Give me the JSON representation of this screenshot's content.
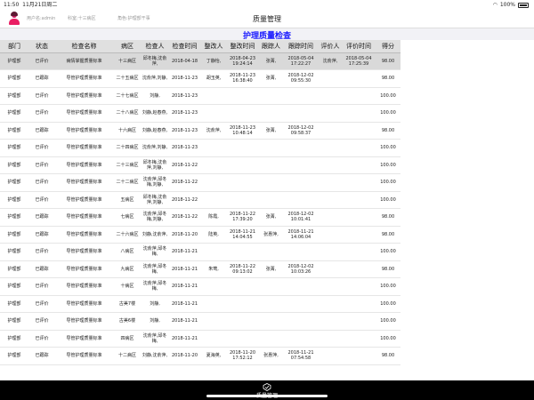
{
  "status_bar": {
    "time": "11:50",
    "date": "11月21日周二",
    "battery": "100%"
  },
  "header": {
    "user": "用户名:admin",
    "ward": "科室:十三病区",
    "role": "角色:护理部干事",
    "title": "质量管理"
  },
  "banner": {
    "title": "护理质量检查"
  },
  "table": {
    "columns": [
      "部门",
      "状态",
      "检查名称",
      "病区",
      "检查人",
      "检查时间",
      "整改人",
      "整改时间",
      "跟踪人",
      "跟踪时间",
      "评价人",
      "评价时间",
      "得分"
    ],
    "rows": [
      [
        "护理部",
        "已评价",
        "病情掌握质量标准",
        "十三病区",
        "邱冬梅,沈俞萍,",
        "2018-04-18",
        "丁静怡,",
        "2018-04-23 19:24:14",
        "张菁,",
        "2018-05-04 17:22:27",
        "沈俞萍,",
        "2018-05-04 17:25:39",
        "98.00"
      ],
      [
        "护理部",
        "已跟踪",
        "导管护理质量标准",
        "二十五病区",
        "沈俞萍,刘静,",
        "2018-11-23",
        "胡玉英,",
        "2018-11-23 16:38:40",
        "张菁,",
        "2018-12-02 09:55:30",
        "",
        "",
        "98.00"
      ],
      [
        "护理部",
        "已评价",
        "导管护理质量标准",
        "二十七病区",
        "刘静,",
        "2018-11-23",
        "",
        "",
        "",
        "",
        "",
        "",
        "100.00"
      ],
      [
        "护理部",
        "已评价",
        "导管护理质量标准",
        "二十八病区",
        "刘静,赵春燕,",
        "2018-11-23",
        "",
        "",
        "",
        "",
        "",
        "",
        "100.00"
      ],
      [
        "护理部",
        "已跟踪",
        "导管护理质量标准",
        "十六病区",
        "刘静,赵春燕,",
        "2018-11-23",
        "沈俞萍,",
        "2018-11-23 10:48:14",
        "张菁,",
        "2018-12-02 09:58:37",
        "",
        "",
        "98.00"
      ],
      [
        "护理部",
        "已评价",
        "导管护理质量标准",
        "二十四病区",
        "沈俞萍,刘静,",
        "2018-11-23",
        "",
        "",
        "",
        "",
        "",
        "",
        "100.00"
      ],
      [
        "护理部",
        "已评价",
        "导管护理质量标准",
        "二十三病区",
        "邱冬梅,沈俞萍,刘静,",
        "2018-11-22",
        "",
        "",
        "",
        "",
        "",
        "",
        "100.00"
      ],
      [
        "护理部",
        "已评价",
        "导管护理质量标准",
        "二十二病区",
        "沈俞萍,邱冬梅,刘静,",
        "2018-11-22",
        "",
        "",
        "",
        "",
        "",
        "",
        "100.00"
      ],
      [
        "护理部",
        "已评价",
        "导管护理质量标准",
        "五病区",
        "邱冬梅,沈俞萍,刘静,",
        "2018-11-22",
        "",
        "",
        "",
        "",
        "",
        "",
        "100.00"
      ],
      [
        "护理部",
        "已跟踪",
        "导管护理质量标准",
        "七病区",
        "沈俞萍,邱冬梅,刘静,",
        "2018-11-22",
        "陈霞,",
        "2018-11-22 17:39:20",
        "张菁,",
        "2018-12-02 10:01:41",
        "",
        "",
        "98.00"
      ],
      [
        "护理部",
        "已跟踪",
        "导管护理质量标准",
        "二十六病区",
        "刘静,沈俞萍,",
        "2018-11-20",
        "陆英,",
        "2018-11-21 14:04:55",
        "张惠萍,",
        "2018-11-21 14:06:04",
        "",
        "",
        "98.00"
      ],
      [
        "护理部",
        "已评价",
        "导管护理质量标准",
        "八病区",
        "沈俞萍,邱冬梅,",
        "2018-11-21",
        "",
        "",
        "",
        "",
        "",
        "",
        "100.00"
      ],
      [
        "护理部",
        "已跟踪",
        "导管护理质量标准",
        "九病区",
        "沈俞萍,邱冬梅,",
        "2018-11-21",
        "朱莺,",
        "2018-11-22 09:13:02",
        "张菁,",
        "2018-12-02 10:03:26",
        "",
        "",
        "98.00"
      ],
      [
        "护理部",
        "已评价",
        "导管护理质量标准",
        "十病区",
        "沈俞萍,邱冬梅,",
        "2018-11-21",
        "",
        "",
        "",
        "",
        "",
        "",
        "100.00"
      ],
      [
        "护理部",
        "已评价",
        "导管护理质量标准",
        "古美7楼",
        "刘静,",
        "2018-11-21",
        "",
        "",
        "",
        "",
        "",
        "",
        "100.00"
      ],
      [
        "护理部",
        "已评价",
        "导管护理质量标准",
        "古美6楼",
        "刘静,",
        "2018-11-21",
        "",
        "",
        "",
        "",
        "",
        "",
        "100.00"
      ],
      [
        "护理部",
        "已评价",
        "导管护理质量标准",
        "四病区",
        "沈俞萍,邱冬梅,",
        "2018-11-21",
        "",
        "",
        "",
        "",
        "",
        "",
        "100.00"
      ],
      [
        "护理部",
        "已跟踪",
        "导管护理质量标准",
        "十二病区",
        "刘静,沈俞萍,",
        "2018-11-20",
        "夏海英,",
        "2018-11-20 17:52:12",
        "张惠萍,",
        "2018-11-21 07:54:58",
        "",
        "",
        "98.00"
      ]
    ]
  },
  "tabbar": {
    "label": "质量管理",
    "icon": "quality-management-icon"
  }
}
